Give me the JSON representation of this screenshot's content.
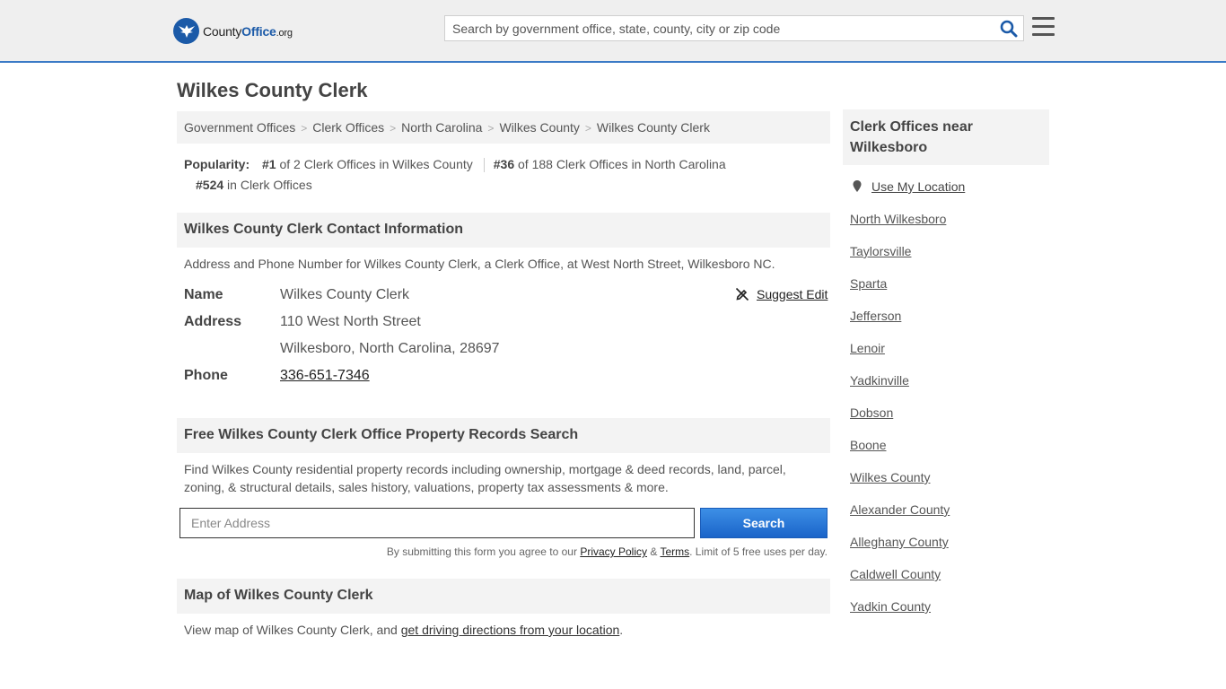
{
  "header": {
    "logo_county": "County",
    "logo_office": "Office",
    "logo_tld": ".org",
    "search_placeholder": "Search by government office, state, county, city or zip code"
  },
  "page": {
    "title": "Wilkes County Clerk"
  },
  "breadcrumb": [
    "Government Offices",
    "Clerk Offices",
    "North Carolina",
    "Wilkes County",
    "Wilkes County Clerk"
  ],
  "popularity": {
    "label": "Popularity:",
    "items": [
      {
        "rank": "#1",
        "text": "of 2 Clerk Offices in Wilkes County"
      },
      {
        "rank": "#36",
        "text": "of 188 Clerk Offices in North Carolina"
      },
      {
        "rank": "#524",
        "text": "in Clerk Offices"
      }
    ]
  },
  "contact": {
    "heading": "Wilkes County Clerk Contact Information",
    "description": "Address and Phone Number for Wilkes County Clerk, a Clerk Office, at West North Street, Wilkesboro NC.",
    "name_label": "Name",
    "name_value": "Wilkes County Clerk",
    "address_label": "Address",
    "address_line1": "110 West North Street",
    "address_line2": "Wilkesboro, North Carolina, 28697",
    "phone_label": "Phone",
    "phone_value": "336-651-7346",
    "suggest_edit": "Suggest Edit"
  },
  "property": {
    "heading": "Free Wilkes County Clerk Office Property Records Search",
    "description": "Find Wilkes County residential property records including ownership, mortgage & deed records, land, parcel, zoning, & structural details, sales history, valuations, property tax assessments & more.",
    "input_placeholder": "Enter Address",
    "button_label": "Search",
    "disclaimer_pre": "By submitting this form you agree to our ",
    "privacy_link": "Privacy Policy",
    "amp": " & ",
    "terms_link": "Terms",
    "disclaimer_post": ". Limit of 5 free uses per day."
  },
  "map": {
    "heading": "Map of Wilkes County Clerk",
    "description_pre": "View map of Wilkes County Clerk, and ",
    "directions_link": "get driving directions from your location",
    "description_post": "."
  },
  "sidebar": {
    "heading": "Clerk Offices near Wilkesboro",
    "use_location": "Use My Location",
    "items": [
      "North Wilkesboro",
      "Taylorsville",
      "Sparta",
      "Jefferson",
      "Lenoir",
      "Yadkinville",
      "Dobson",
      "Boone",
      "Wilkes County",
      "Alexander County",
      "Alleghany County",
      "Caldwell County",
      "Yadkin County"
    ]
  },
  "colors": {
    "accent": "#1b5aa8",
    "button": "#1a64c9",
    "header_bg": "#efefef",
    "section_bg": "#f3f3f3"
  }
}
